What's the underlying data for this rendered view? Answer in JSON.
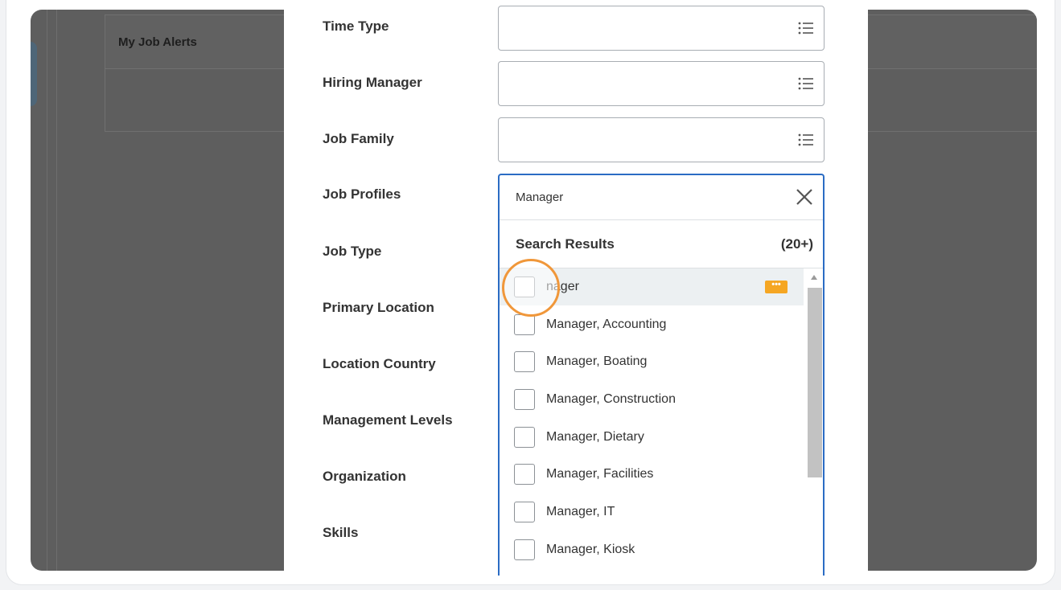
{
  "background": {
    "alerts_title": "My Job Alerts"
  },
  "form": {
    "fields": [
      {
        "label": "Time Type"
      },
      {
        "label": "Hiring Manager"
      },
      {
        "label": "Job Family"
      },
      {
        "label": "Job Profiles"
      },
      {
        "label": "Job Type"
      },
      {
        "label": "Primary Location"
      },
      {
        "label": "Location Country"
      },
      {
        "label": "Management Levels"
      },
      {
        "label": "Organization"
      },
      {
        "label": "Skills"
      }
    ],
    "job_profiles": {
      "search_value": "Manager",
      "results_title": "Search Results",
      "results_count": "(20+)",
      "results": [
        {
          "label": "nager",
          "active": true,
          "badge": "•••"
        },
        {
          "label": "Manager, Accounting"
        },
        {
          "label": "Manager, Boating"
        },
        {
          "label": "Manager, Construction"
        },
        {
          "label": "Manager, Dietary"
        },
        {
          "label": "Manager, Facilities"
        },
        {
          "label": "Manager, IT"
        },
        {
          "label": "Manager, Kiosk"
        }
      ]
    }
  },
  "colors": {
    "accent_blue": "#2b6cc4",
    "badge_orange": "#f5a623",
    "cursor_orange": "#f0973a",
    "overlay_gray": "#5e5e5e"
  },
  "icons": {
    "list": "list-icon",
    "clear": "close-icon",
    "scroll_up": "scroll-up-arrow-icon"
  }
}
